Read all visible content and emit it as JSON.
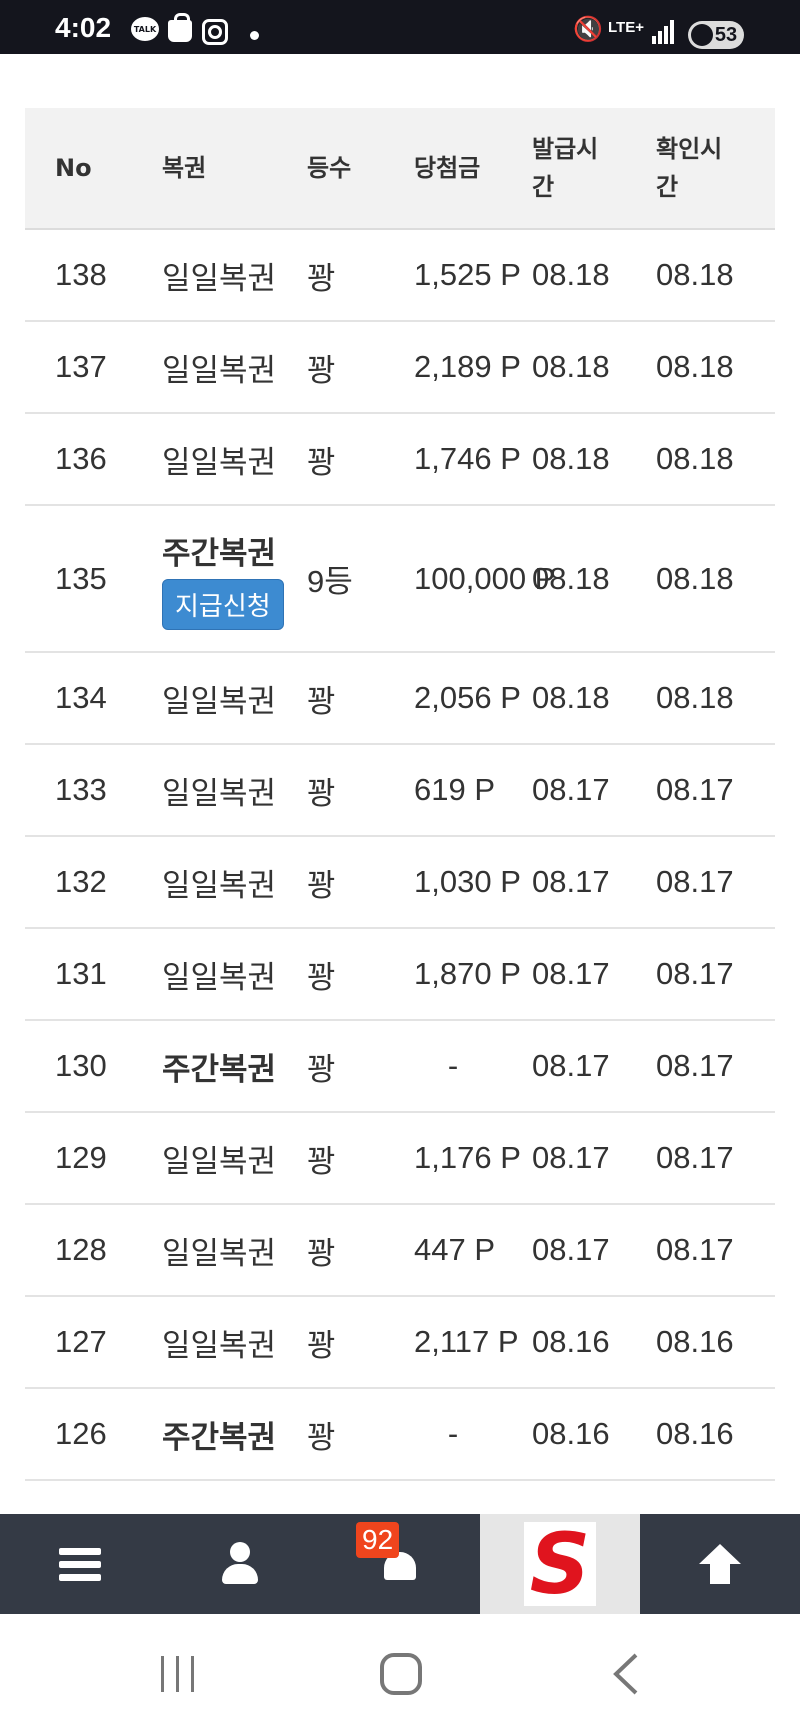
{
  "status_bar": {
    "time": "4:02",
    "talk_label": "TALK",
    "network": "LTE+",
    "battery": "53"
  },
  "table": {
    "headers": [
      "No",
      "복권",
      "등수",
      "당첨금",
      "발급시간",
      "확인시간"
    ],
    "rows": [
      {
        "no": "138",
        "type": "일일복권",
        "bold": false,
        "rank": "꽝",
        "prize": "1,525 P",
        "issued": "08.18",
        "checked": "08.18"
      },
      {
        "no": "137",
        "type": "일일복권",
        "bold": false,
        "rank": "꽝",
        "prize": "2,189 P",
        "issued": "08.18",
        "checked": "08.18"
      },
      {
        "no": "136",
        "type": "일일복권",
        "bold": false,
        "rank": "꽝",
        "prize": "1,746 P",
        "issued": "08.18",
        "checked": "08.18"
      },
      {
        "no": "135",
        "type": "주간복권",
        "bold": true,
        "button": "지급신청",
        "rank": "9등",
        "prize": "100,000 P",
        "issued": "08.18",
        "checked": "08.18"
      },
      {
        "no": "134",
        "type": "일일복권",
        "bold": false,
        "rank": "꽝",
        "prize": "2,056 P",
        "issued": "08.18",
        "checked": "08.18"
      },
      {
        "no": "133",
        "type": "일일복권",
        "bold": false,
        "rank": "꽝",
        "prize": "619 P",
        "issued": "08.17",
        "checked": "08.17"
      },
      {
        "no": "132",
        "type": "일일복권",
        "bold": false,
        "rank": "꽝",
        "prize": "1,030 P",
        "issued": "08.17",
        "checked": "08.17"
      },
      {
        "no": "131",
        "type": "일일복권",
        "bold": false,
        "rank": "꽝",
        "prize": "1,870 P",
        "issued": "08.17",
        "checked": "08.17"
      },
      {
        "no": "130",
        "type": "주간복권",
        "bold": true,
        "rank": "꽝",
        "prize": "-",
        "issued": "08.17",
        "checked": "08.17"
      },
      {
        "no": "129",
        "type": "일일복권",
        "bold": false,
        "rank": "꽝",
        "prize": "1,176 P",
        "issued": "08.17",
        "checked": "08.17"
      },
      {
        "no": "128",
        "type": "일일복권",
        "bold": false,
        "rank": "꽝",
        "prize": "447 P",
        "issued": "08.17",
        "checked": "08.17"
      },
      {
        "no": "127",
        "type": "일일복권",
        "bold": false,
        "rank": "꽝",
        "prize": "2,117 P",
        "issued": "08.16",
        "checked": "08.16"
      },
      {
        "no": "126",
        "type": "주간복권",
        "bold": true,
        "rank": "꽝",
        "prize": "-",
        "issued": "08.16",
        "checked": "08.16"
      }
    ]
  },
  "bottom_nav": {
    "items": [
      "menu-icon",
      "user-icon",
      "bell-icon",
      "site-logo",
      "arrow-up-icon"
    ],
    "notification_count": "92",
    "logo_letter": "S"
  },
  "colors": {
    "status_bar": "#14151d",
    "header_bg": "#f2f2f2",
    "claim_button": "#3d8bd1",
    "nav_bg": "#343a45",
    "badge": "#f0451d",
    "logo": "#e0141e"
  }
}
